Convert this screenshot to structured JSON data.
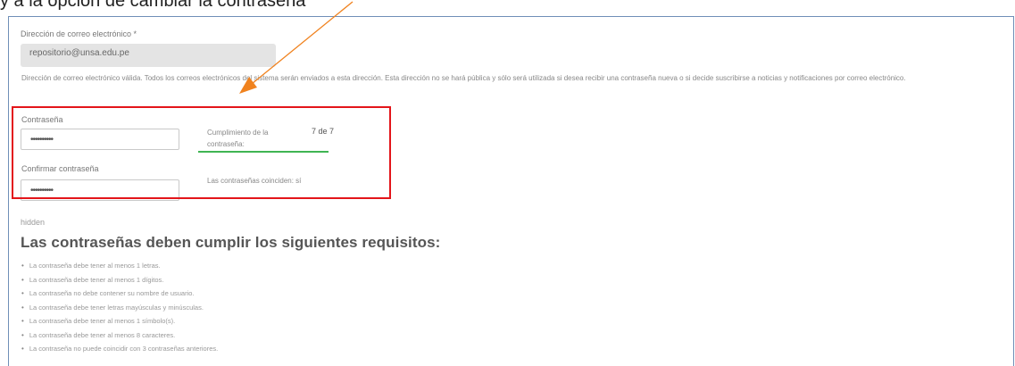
{
  "top_strip_text": "y a la opción de cambiar la contraseña",
  "email": {
    "label": "Dirección de correo electrónico *",
    "value": "repositorio@unsa.edu.pe",
    "help": "Dirección de correo electrónico válida. Todos los correos electrónicos del sistema serán enviados a esta dirección. Esta dirección no se hará pública y sólo será utilizada si desea recibir una contraseña nueva o si decide suscribirse a noticias y notificaciones por correo electrónico."
  },
  "password": {
    "label": "Contraseña",
    "value": "••••••••••",
    "strength_label": "Cumplimiento de la contraseña:",
    "strength_count": "7 de 7",
    "strength_fraction": 1.0,
    "strength_color": "#3fb553"
  },
  "confirm": {
    "label": "Confirmar contraseña",
    "value": "••••••••••",
    "match_text": "Las contraseñas coinciden: sí"
  },
  "hidden_label": "hidden",
  "requirements": {
    "heading": "Las contraseñas deben cumplir los siguientes requisitos:",
    "items": [
      "La contraseña debe tener al menos 1 letras.",
      "La contraseña debe tener al menos 1 dígitos.",
      "La contraseña no debe contener su nombre de usuario.",
      "La contraseña debe tener letras mayúsculas y minúsculas.",
      "La contraseña debe tener al menos 1 símbolo(s).",
      "La contraseña debe tener al menos 8 caracteres.",
      "La contraseña no puede coincidir con 3 contraseñas anteriores."
    ]
  },
  "colors": {
    "highlight_box": "#e3151a",
    "arrow": "#f0821e",
    "frame": "#6f8fb8"
  }
}
